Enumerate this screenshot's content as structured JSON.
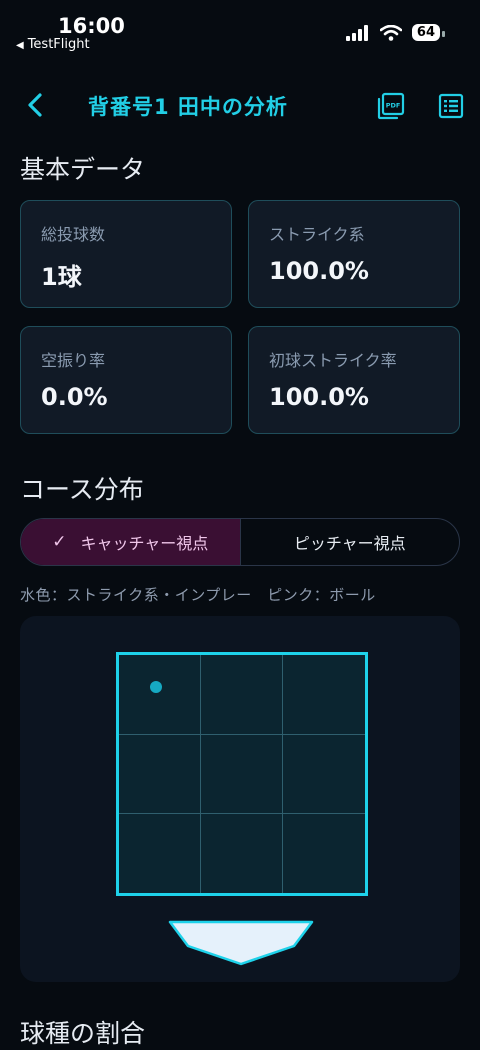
{
  "status": {
    "time": "16:00",
    "back_app": "TestFlight",
    "battery": "64"
  },
  "nav": {
    "title": "背番号1 田中の分析"
  },
  "sections": {
    "basic": "基本データ",
    "course": "コース分布",
    "pitch_types": "球種の割合"
  },
  "stats": [
    {
      "label": "総投球数",
      "value": "1球"
    },
    {
      "label": "ストライク系",
      "value": "100.0%"
    },
    {
      "label": "空振り率",
      "value": "0.0%"
    },
    {
      "label": "初球ストライク率",
      "value": "100.0%"
    }
  ],
  "view_toggle": {
    "catcher": "キャッチャー視点",
    "pitcher": "ピッチャー視点",
    "selected": "catcher"
  },
  "legend": "水色：ストライク系・インプレー　ピンク：ボール",
  "colors": {
    "accent": "#22cfe6",
    "strike": "#16a9c2",
    "ball": "#e04fb0",
    "toggle_active": "#3a0f33"
  },
  "pitches": [
    {
      "type": "strike",
      "zone_x": 0.15,
      "zone_y": 0.135
    }
  ]
}
